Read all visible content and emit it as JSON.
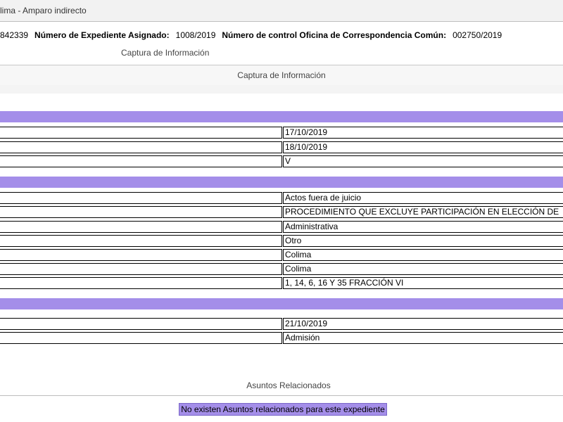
{
  "window": {
    "title": "lima - Amparo indirecto"
  },
  "info": {
    "id_fragment": "842339",
    "expediente_label": "Número de Expediente Asignado:",
    "expediente_value": "1008/2019",
    "control_label": "Número de control Oficina de Correspondencia Común:",
    "control_value": "002750/2019"
  },
  "subheading": "Captura de Información",
  "captura_bar": "Captura de Información",
  "section1": {
    "values": [
      "17/10/2019",
      "18/10/2019",
      "V"
    ]
  },
  "section2": {
    "values": [
      "Actos fuera de juicio",
      "PROCEDIMIENTO QUE EXCLUYE PARTICIPACIÓN EN ELECCIÓN DE",
      "Administrativa",
      "Otro",
      "Colima",
      "Colima",
      "1, 14, 6, 16 Y 35 FRACCIÓN VI"
    ]
  },
  "section3": {
    "values": [
      "21/10/2019",
      "Admisión"
    ]
  },
  "related": {
    "title": "Asuntos Relacionados",
    "empty_message": "No existen Asuntos relacionados para este expediente"
  },
  "colors": {
    "band": "#a48ee9",
    "border": "#000000"
  }
}
